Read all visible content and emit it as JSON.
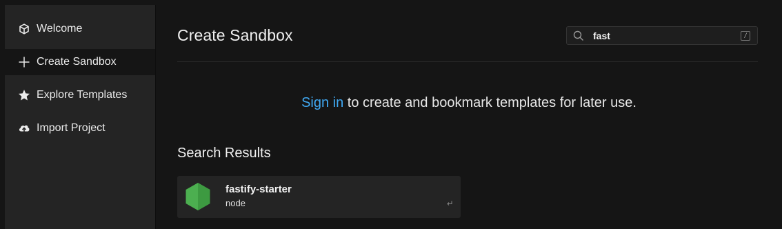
{
  "sidebar": {
    "items": [
      {
        "label": "Welcome",
        "icon": "cube-icon",
        "active": false
      },
      {
        "label": "Create Sandbox",
        "icon": "plus-icon",
        "active": true
      },
      {
        "label": "Explore Templates",
        "icon": "star-icon",
        "active": false
      },
      {
        "label": "Import Project",
        "icon": "cloud-upload-icon",
        "active": false
      }
    ]
  },
  "header": {
    "title": "Create Sandbox",
    "search": {
      "value": "fast",
      "shortcut": "/"
    }
  },
  "signin": {
    "link": "Sign in",
    "text": " to create and bookmark templates for later use."
  },
  "results": {
    "title": "Search Results",
    "items": [
      {
        "name": "fastify-starter",
        "environment": "node",
        "logo": "nodejs-hexagon-icon"
      }
    ]
  },
  "colors": {
    "accent_link": "#40a9f3",
    "sidebar_bg": "#242424",
    "main_bg": "#151515",
    "node_green": "#4caf50"
  }
}
